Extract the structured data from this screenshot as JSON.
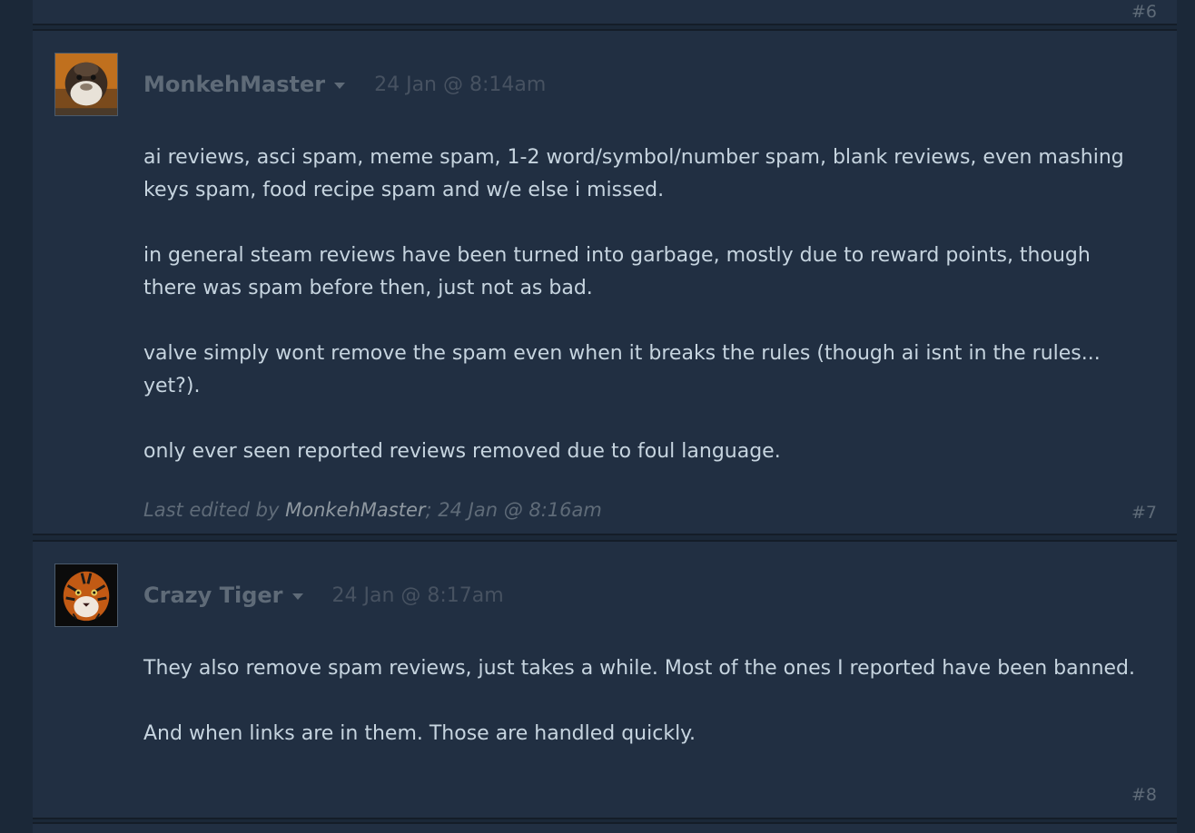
{
  "posts": {
    "prev": {
      "number": "#6"
    },
    "post7": {
      "author": "MonkehMaster",
      "avatar_icon": "monkey-avatar",
      "timestamp": "24 Jan @ 8:14am",
      "paragraphs": [
        "ai reviews, asci spam, meme spam, 1-2 word/symbol/number spam, blank reviews, even mashing keys spam, food recipe spam and w/e else i missed.",
        "in general steam reviews have been turned into garbage, mostly due to reward points, though there was spam before then, just not as bad.",
        "valve simply wont remove the spam even when it breaks the rules (though ai isnt in the rules... yet?).",
        "only ever seen reported reviews removed due to foul language."
      ],
      "edited_prefix": "Last edited by ",
      "edited_by": "MonkehMaster",
      "edited_suffix": "; 24 Jan @ 8:16am",
      "number": "#7"
    },
    "post8": {
      "author": "Crazy Tiger",
      "avatar_icon": "tiger-avatar",
      "timestamp": "24 Jan @ 8:17am",
      "paragraphs": [
        "They also remove spam reviews, just takes a while. Most of the ones I reported have been banned.",
        "And when links are in them. Those are handled quickly."
      ],
      "number": "#8"
    }
  },
  "colors": {
    "page_bg": "#1b2838",
    "post_bg": "#212f42",
    "body_text": "#c6d4df",
    "muted_text": "#5f6b78"
  }
}
